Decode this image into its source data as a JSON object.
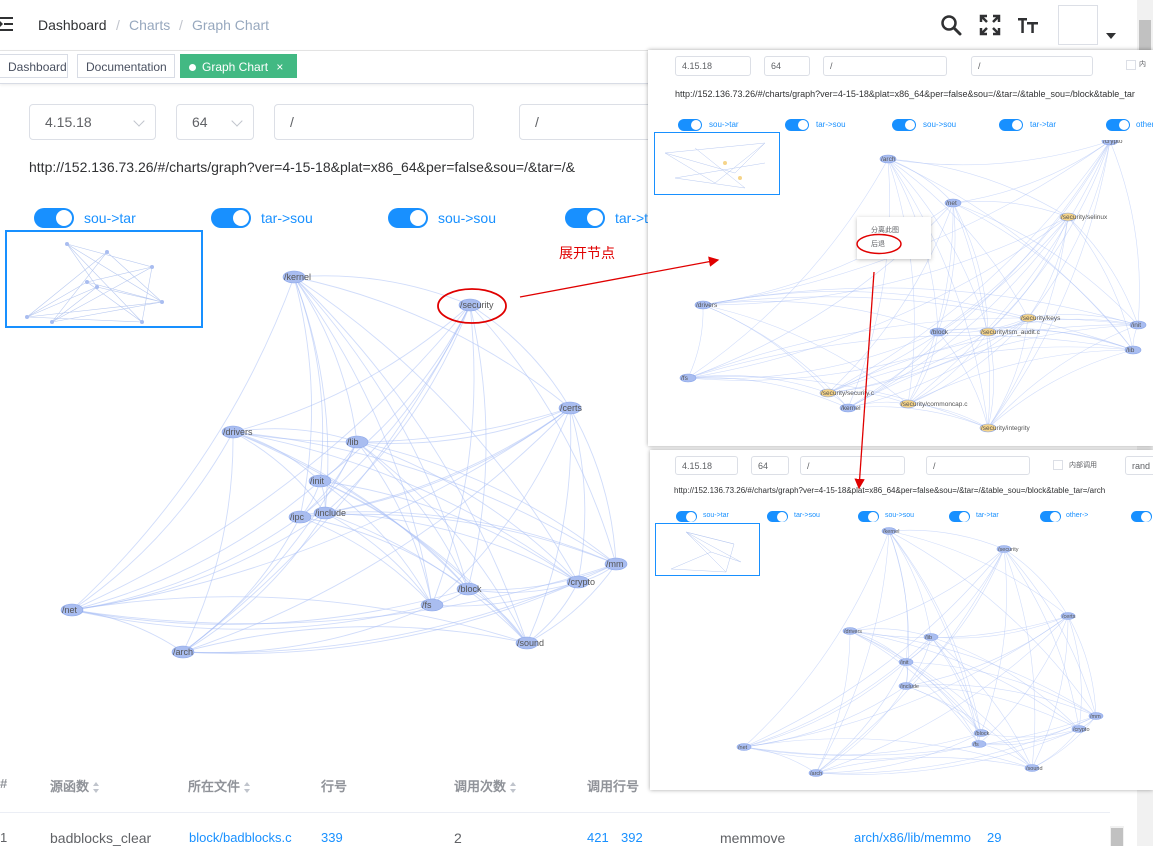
{
  "navbar": {
    "breadcrumb": [
      "Dashboard",
      "Charts",
      "Graph Chart"
    ],
    "separator": "/"
  },
  "tags": [
    {
      "label": "Dashboard"
    },
    {
      "label": "Documentation"
    },
    {
      "label": "Graph Chart",
      "close": "×"
    }
  ],
  "filters": {
    "version": "4.15.18",
    "platform": "64",
    "source_path": "/",
    "target_path": "/"
  },
  "url": "http://152.136.73.26/#/charts/graph?ver=4-15-18&plat=x86_64&per=false&sou=/&tar=/&",
  "switches": [
    "sou->tar",
    "tar->sou",
    "sou->sou",
    "tar->t"
  ],
  "graph": {
    "nodes": [
      "/kernel",
      "/security",
      "/certs",
      "/drivers",
      "/lib",
      "/init",
      "/ipc",
      "/include",
      "/mm",
      "/crypto",
      "/block",
      "/fs",
      "/net",
      "/arch",
      "/sound"
    ]
  },
  "table": {
    "headers": [
      "#",
      "源函数",
      "所在文件",
      "行号",
      "调用次数",
      "调用行号",
      "",
      "",
      ""
    ],
    "rows": [
      {
        "index": "1",
        "func": "badblocks_clear",
        "file": "block/badblocks.c",
        "line": "339",
        "count": "2",
        "call_lines": [
          "421",
          "392"
        ],
        "callee": "memmove",
        "callee_file": "arch/x86/lib/memmo",
        "callee_line": "29"
      }
    ]
  },
  "annotations": {
    "expand_node": "展开节点",
    "back": "后退"
  },
  "shot1": {
    "version": "4.15.18",
    "platform": "64",
    "source_path": "/",
    "target_path": "/",
    "checkbox_label": "内",
    "url": "http://152.136.73.26/#/charts/graph?ver=4-15-18&plat=x86_64&per=false&sou=/&tar=/&table_sou=/block&table_tar",
    "switches": [
      "sou->tar",
      "tar->sou",
      "sou->sou",
      "tar->tar",
      "other"
    ],
    "context_menu": [
      "分离此图",
      "后退"
    ],
    "nodes": [
      "/crypto",
      "/arch",
      "/net",
      "/security/selinux",
      "/drivers",
      "/security/keys",
      "/block",
      "/security/lsm_audit.c",
      "/fs",
      "/security/security.c",
      "/kernel",
      "/security/commoncap.c",
      "/security/integrity",
      "/lib",
      "/init"
    ]
  },
  "shot2": {
    "version": "4.15.18",
    "platform": "64",
    "source_path": "/",
    "target_path": "/",
    "checkbox_label": "内部调用",
    "random_label": "rand",
    "url": "http://152.136.73.26/#/charts/graph?ver=4-15-18&plat=x86_64&per=false&sou=/&tar=/&table_sou=/block&table_tar=/arch",
    "switches": [
      "sou->tar",
      "tar->sou",
      "sou->sou",
      "tar->tar",
      "other->"
    ],
    "nodes": [
      "/kernel",
      "/security",
      "/certs",
      "/drivers",
      "/lib",
      "/init",
      "/include",
      "/mm",
      "/crypto",
      "/fs",
      "/block",
      "/net",
      "/arch",
      "/sound"
    ]
  }
}
